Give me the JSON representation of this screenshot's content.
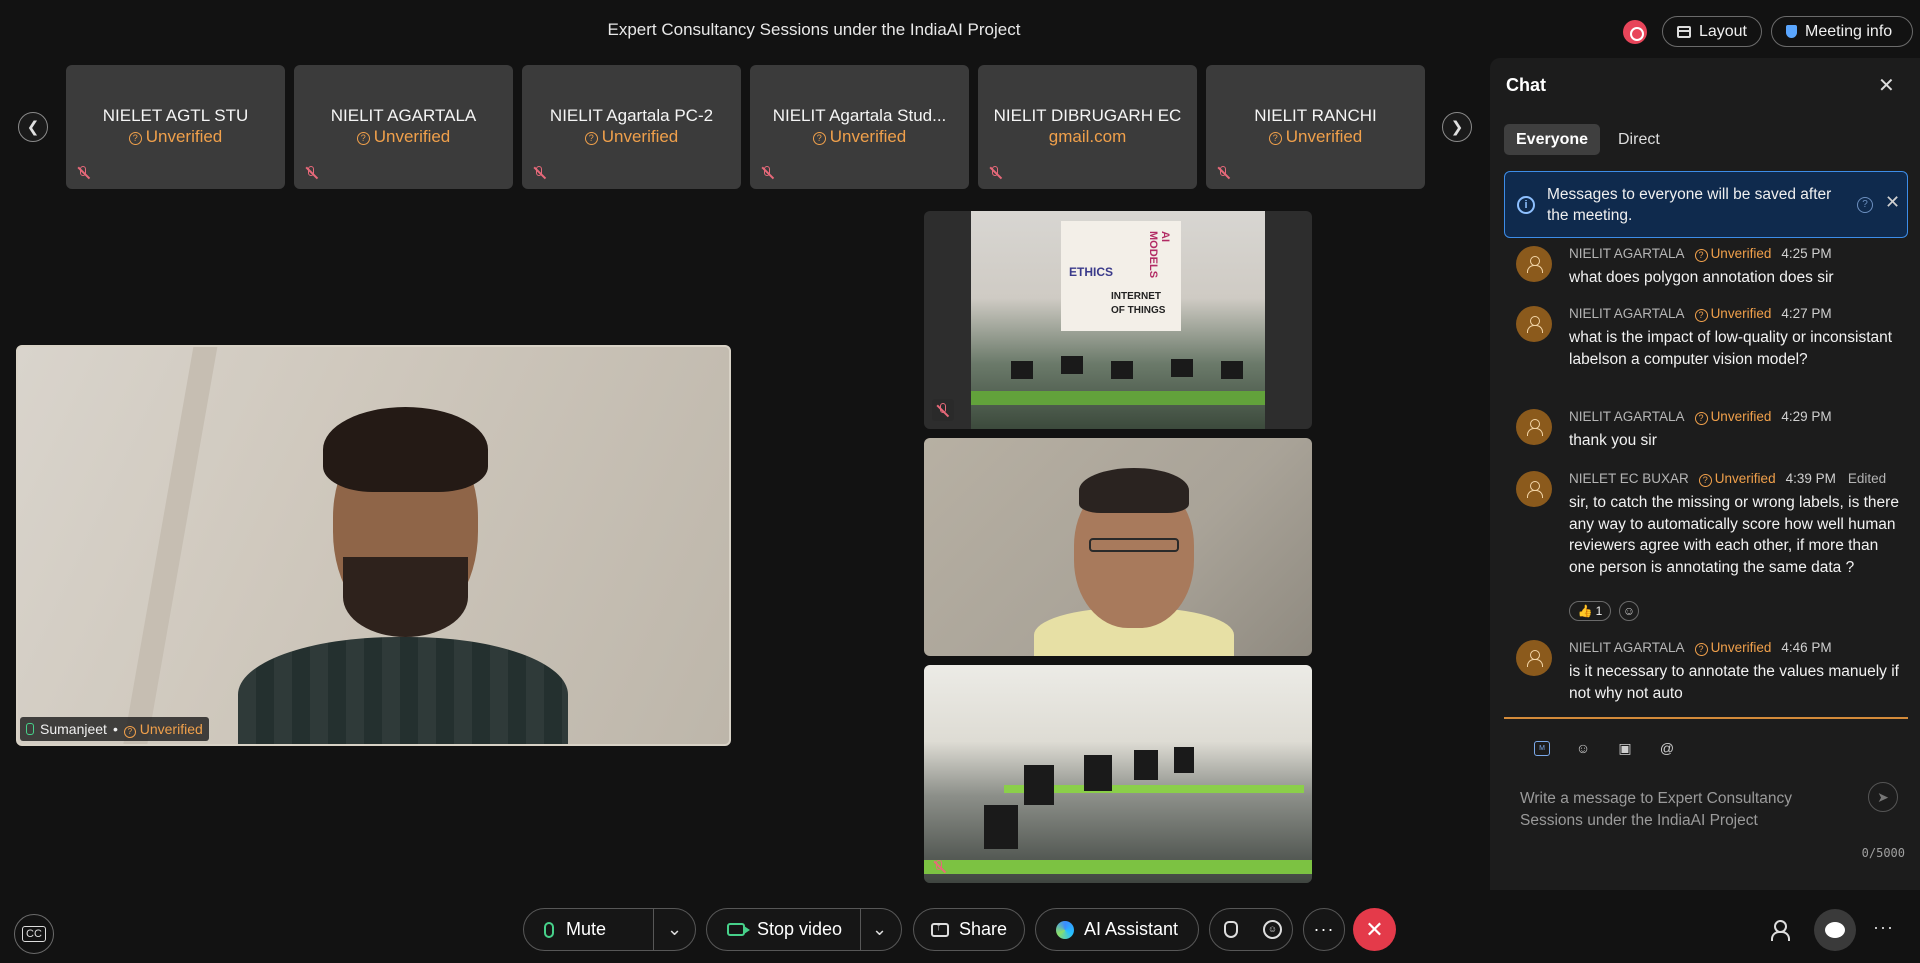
{
  "meeting": {
    "title": "Expert Consultancy Sessions under the IndiaAI Project",
    "layout_label": "Layout",
    "info_label": "Meeting info"
  },
  "colors": {
    "unverified": "#f0a04b",
    "accent_blue": "#3d8de8",
    "leave_red": "#e43a4a",
    "mic_green": "#47d18a",
    "record_red": "#e8455a"
  },
  "filmstrip": {
    "prev_icon": "chevron-left-icon",
    "next_icon": "chevron-right-icon",
    "tiles": [
      {
        "name": "NIELET AGTL STU",
        "status": "Unverified",
        "status_icon": "?"
      },
      {
        "name": "NIELIT AGARTALA",
        "status": "Unverified",
        "status_icon": "?"
      },
      {
        "name": "NIELIT Agartala PC-2",
        "status": "Unverified",
        "status_icon": "?"
      },
      {
        "name": "NIELIT Agartala Stud...",
        "status": "Unverified",
        "status_icon": "?"
      },
      {
        "name": "NIELIT DIBRUGARH EC",
        "status": "gmail.com",
        "status_icon": ""
      },
      {
        "name": "NIELIT RANCHI",
        "status": "Unverified",
        "status_icon": "?"
      }
    ]
  },
  "main_video": {
    "name": "Sumanjeet",
    "separator": "•",
    "status": "Unverified",
    "status_icon": "?"
  },
  "poster": {
    "lines": [
      "ETHICS",
      "INTERNET",
      "OF THINGS",
      "AI MODELS"
    ]
  },
  "chat": {
    "title": "Chat",
    "close_icon": "close-icon",
    "tabs": [
      "Everyone",
      "Direct"
    ],
    "notice": "Messages to everyone will be saved after the meeting.",
    "notice_help": "?",
    "messages": [
      {
        "sender": "NIELIT AGARTALA",
        "status": "Unverified",
        "time": "4:25 PM",
        "edited": "",
        "text": "what does polygon annotation does sir"
      },
      {
        "sender": "NIELIT AGARTALA",
        "status": "Unverified",
        "time": "4:27 PM",
        "edited": "",
        "text": "what is the impact of low-quality or inconsistant labelson a computer vision model?"
      },
      {
        "sender": "NIELIT AGARTALA",
        "status": "Unverified",
        "time": "4:29 PM",
        "edited": "",
        "text": "thank you sir"
      },
      {
        "sender": "NIELET EC BUXAR",
        "status": "Unverified",
        "time": "4:39 PM",
        "edited": "Edited",
        "text": "sir, to catch the missing or wrong labels, is there any way to automatically score how well human reviewers agree with each other, if more than one person is annotating the same data ?",
        "reaction_emoji": "👍",
        "reaction_count": "1"
      },
      {
        "sender": "NIELIT AGARTALA",
        "status": "Unverified",
        "time": "4:46 PM",
        "edited": "",
        "text": "is it necessary to annotate the values manuely if not why not auto"
      }
    ],
    "status_icon": "?",
    "composer": {
      "placeholder": "Write a message to Expert Consultancy Sessions under the IndiaAI Project",
      "counter": "0/5000",
      "md_label": "M",
      "send_icon": "send-icon"
    }
  },
  "controls": {
    "cc_label": "CC",
    "mute_label": "Mute",
    "video_label": "Stop video",
    "share_label": "Share",
    "ai_label": "AI Assistant",
    "more_label": "···",
    "leave_label": "✕",
    "caret": "⌄"
  }
}
